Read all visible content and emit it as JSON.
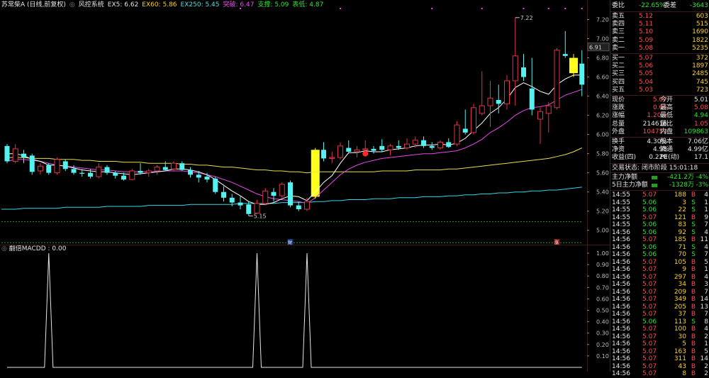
{
  "colors": {
    "bg": "#000000",
    "up": "#e0324a",
    "down": "#55f0f0",
    "ma5": "#ffffff",
    "ex60": "#e6e04a",
    "ex250": "#33d6e6",
    "tupo": "#e64ae6",
    "highlight": "#ffff1e",
    "red": "#ff4d4d",
    "green": "#2ee52e",
    "yellow": "#ffd21e"
  },
  "header": {
    "stock": "苏常柴A (日线,前复权)",
    "indicator": "风控系统",
    "ex5": "EX5: 6.62",
    "ex60": "EX60: 5.86",
    "ex250": "EX250: 5.45",
    "tupo": "突破: 6.47",
    "zhicheng": "支撑: 5.09",
    "biaodi": "表低: 4.87"
  },
  "sub": {
    "title": "翻倍MACDD : 0.00"
  },
  "chart_data": [
    {
      "type": "candlestick",
      "title": "苏常柴A (日线,前复权)",
      "ylim": [
        4.85,
        7.3
      ],
      "yticks": [
        "7.20",
        "7.00",
        "6.80",
        "6.60",
        "6.40",
        "6.20",
        "6.00",
        "5.80",
        "5.60",
        "5.40",
        "5.20",
        "5.00"
      ],
      "last_price_label": "6.91",
      "candles": [
        {
          "o": 5.88,
          "h": 5.9,
          "l": 5.7,
          "c": 5.72
        },
        {
          "o": 5.72,
          "h": 5.9,
          "l": 5.7,
          "c": 5.85
        },
        {
          "o": 5.8,
          "h": 5.84,
          "l": 5.7,
          "c": 5.76
        },
        {
          "o": 5.78,
          "h": 5.8,
          "l": 5.58,
          "c": 5.61
        },
        {
          "o": 5.62,
          "h": 5.7,
          "l": 5.58,
          "c": 5.67
        },
        {
          "o": 5.68,
          "h": 5.7,
          "l": 5.58,
          "c": 5.6
        },
        {
          "o": 5.6,
          "h": 5.76,
          "l": 5.58,
          "c": 5.74
        },
        {
          "o": 5.72,
          "h": 5.74,
          "l": 5.62,
          "c": 5.64
        },
        {
          "o": 5.64,
          "h": 5.68,
          "l": 5.58,
          "c": 5.6
        },
        {
          "o": 5.6,
          "h": 5.64,
          "l": 5.56,
          "c": 5.59
        },
        {
          "o": 5.6,
          "h": 5.64,
          "l": 5.54,
          "c": 5.56
        },
        {
          "o": 5.56,
          "h": 5.7,
          "l": 5.54,
          "c": 5.66
        },
        {
          "o": 5.66,
          "h": 5.68,
          "l": 5.58,
          "c": 5.6
        },
        {
          "o": 5.6,
          "h": 5.62,
          "l": 5.54,
          "c": 5.57
        },
        {
          "o": 5.57,
          "h": 5.6,
          "l": 5.52,
          "c": 5.53
        },
        {
          "o": 5.53,
          "h": 5.64,
          "l": 5.52,
          "c": 5.62
        },
        {
          "o": 5.62,
          "h": 5.7,
          "l": 5.58,
          "c": 5.6
        },
        {
          "o": 5.6,
          "h": 5.64,
          "l": 5.56,
          "c": 5.62
        },
        {
          "o": 5.62,
          "h": 5.68,
          "l": 5.58,
          "c": 5.66
        },
        {
          "o": 5.66,
          "h": 5.72,
          "l": 5.62,
          "c": 5.63
        },
        {
          "o": 5.64,
          "h": 5.72,
          "l": 5.62,
          "c": 5.7
        },
        {
          "o": 5.7,
          "h": 5.72,
          "l": 5.62,
          "c": 5.63
        },
        {
          "o": 5.63,
          "h": 5.66,
          "l": 5.55,
          "c": 5.58
        },
        {
          "o": 5.58,
          "h": 5.62,
          "l": 5.5,
          "c": 5.55
        },
        {
          "o": 5.56,
          "h": 5.6,
          "l": 5.5,
          "c": 5.53
        },
        {
          "o": 5.54,
          "h": 5.56,
          "l": 5.38,
          "c": 5.4
        },
        {
          "o": 5.4,
          "h": 5.46,
          "l": 5.3,
          "c": 5.34
        },
        {
          "o": 5.34,
          "h": 5.38,
          "l": 5.25,
          "c": 5.29
        },
        {
          "o": 5.29,
          "h": 5.36,
          "l": 5.22,
          "c": 5.26
        },
        {
          "o": 5.27,
          "h": 5.3,
          "l": 5.15,
          "c": 5.17
        },
        {
          "o": 5.18,
          "h": 5.32,
          "l": 5.17,
          "c": 5.28
        },
        {
          "o": 5.28,
          "h": 5.44,
          "l": 5.26,
          "c": 5.41
        },
        {
          "o": 5.4,
          "h": 5.44,
          "l": 5.3,
          "c": 5.36
        },
        {
          "o": 5.36,
          "h": 5.5,
          "l": 5.34,
          "c": 5.48
        },
        {
          "o": 5.5,
          "h": 5.52,
          "l": 5.24,
          "c": 5.26
        },
        {
          "o": 5.26,
          "h": 5.3,
          "l": 5.2,
          "c": 5.22
        },
        {
          "o": 5.22,
          "h": 5.34,
          "l": 5.2,
          "c": 5.3
        },
        {
          "o": 5.35,
          "h": 5.86,
          "l": 5.33,
          "c": 5.84
        },
        {
          "o": 5.84,
          "h": 5.92,
          "l": 5.72,
          "c": 5.75
        },
        {
          "o": 5.75,
          "h": 5.82,
          "l": 5.7,
          "c": 5.76
        },
        {
          "o": 5.76,
          "h": 5.92,
          "l": 5.74,
          "c": 5.88
        },
        {
          "o": 5.86,
          "h": 5.94,
          "l": 5.8,
          "c": 5.82
        },
        {
          "o": 5.82,
          "h": 5.88,
          "l": 5.76,
          "c": 5.84
        },
        {
          "o": 5.84,
          "h": 5.94,
          "l": 5.8,
          "c": 5.85
        },
        {
          "o": 5.85,
          "h": 5.88,
          "l": 5.8,
          "c": 5.83
        },
        {
          "o": 5.88,
          "h": 5.95,
          "l": 5.82,
          "c": 5.84
        },
        {
          "o": 5.84,
          "h": 5.9,
          "l": 5.78,
          "c": 5.88
        },
        {
          "o": 5.88,
          "h": 5.94,
          "l": 5.84,
          "c": 5.86
        },
        {
          "o": 5.86,
          "h": 5.96,
          "l": 5.84,
          "c": 5.9
        },
        {
          "o": 5.9,
          "h": 5.98,
          "l": 5.86,
          "c": 5.94
        },
        {
          "o": 5.94,
          "h": 5.98,
          "l": 5.86,
          "c": 5.88
        },
        {
          "o": 5.88,
          "h": 5.92,
          "l": 5.84,
          "c": 5.86
        },
        {
          "o": 5.86,
          "h": 5.94,
          "l": 5.84,
          "c": 5.92
        },
        {
          "o": 5.92,
          "h": 5.96,
          "l": 5.86,
          "c": 5.87
        },
        {
          "o": 5.9,
          "h": 6.14,
          "l": 5.88,
          "c": 6.1
        },
        {
          "o": 6.06,
          "h": 6.26,
          "l": 6.0,
          "c": 6.02
        },
        {
          "o": 6.02,
          "h": 6.32,
          "l": 6.0,
          "c": 6.28
        },
        {
          "o": 6.22,
          "h": 6.66,
          "l": 6.2,
          "c": 6.3
        },
        {
          "o": 6.3,
          "h": 6.56,
          "l": 6.08,
          "c": 6.38
        },
        {
          "o": 6.36,
          "h": 6.52,
          "l": 6.22,
          "c": 6.32
        },
        {
          "o": 6.32,
          "h": 6.62,
          "l": 6.26,
          "c": 6.56
        },
        {
          "o": 6.56,
          "h": 7.22,
          "l": 6.3,
          "c": 6.82
        },
        {
          "o": 6.7,
          "h": 6.84,
          "l": 6.56,
          "c": 6.6
        },
        {
          "o": 6.48,
          "h": 6.8,
          "l": 6.2,
          "c": 6.26
        },
        {
          "o": 6.16,
          "h": 6.28,
          "l": 5.9,
          "c": 6.24
        },
        {
          "o": 6.22,
          "h": 6.34,
          "l": 6.02,
          "c": 6.3
        },
        {
          "o": 6.28,
          "h": 6.9,
          "l": 6.26,
          "c": 6.88
        },
        {
          "o": 6.84,
          "h": 7.08,
          "l": 6.8,
          "c": 6.82
        },
        {
          "o": 6.8,
          "h": 6.84,
          "l": 6.6,
          "c": 6.64
        },
        {
          "o": 6.74,
          "h": 6.88,
          "l": 6.4,
          "c": 6.52
        }
      ],
      "highlight_candles": [
        37,
        68
      ],
      "lines": {
        "ma5": [
          5.8,
          5.8,
          5.78,
          5.74,
          5.72,
          5.68,
          5.68,
          5.67,
          5.65,
          5.63,
          5.62,
          5.61,
          5.61,
          5.6,
          5.59,
          5.58,
          5.59,
          5.6,
          5.61,
          5.62,
          5.64,
          5.64,
          5.63,
          5.61,
          5.58,
          5.53,
          5.47,
          5.41,
          5.36,
          5.3,
          5.27,
          5.27,
          5.29,
          5.33,
          5.36,
          5.35,
          5.31,
          5.4,
          5.5,
          5.57,
          5.7,
          5.81,
          5.81,
          5.83,
          5.82,
          5.82,
          5.84,
          5.85,
          5.86,
          5.88,
          5.89,
          5.89,
          5.9,
          5.89,
          5.91,
          5.96,
          6.04,
          6.12,
          6.22,
          6.28,
          6.37,
          6.49,
          6.54,
          6.5,
          6.45,
          6.42,
          6.52,
          6.58,
          6.62,
          6.62
        ],
        "ex60": [
          5.76,
          5.76,
          5.76,
          5.75,
          5.75,
          5.75,
          5.74,
          5.74,
          5.74,
          5.73,
          5.73,
          5.72,
          5.72,
          5.72,
          5.71,
          5.71,
          5.71,
          5.7,
          5.7,
          5.7,
          5.7,
          5.69,
          5.69,
          5.68,
          5.68,
          5.67,
          5.66,
          5.66,
          5.65,
          5.64,
          5.63,
          5.63,
          5.62,
          5.62,
          5.61,
          5.61,
          5.6,
          5.61,
          5.61,
          5.61,
          5.61,
          5.61,
          5.61,
          5.61,
          5.61,
          5.62,
          5.62,
          5.62,
          5.62,
          5.63,
          5.63,
          5.63,
          5.63,
          5.64,
          5.64,
          5.65,
          5.66,
          5.67,
          5.68,
          5.69,
          5.7,
          5.71,
          5.72,
          5.73,
          5.74,
          5.75,
          5.77,
          5.79,
          5.82,
          5.86
        ],
        "ex250": [
          5.22,
          5.22,
          5.23,
          5.23,
          5.23,
          5.23,
          5.23,
          5.24,
          5.24,
          5.24,
          5.24,
          5.24,
          5.25,
          5.25,
          5.25,
          5.25,
          5.25,
          5.26,
          5.26,
          5.26,
          5.26,
          5.26,
          5.27,
          5.27,
          5.27,
          5.27,
          5.27,
          5.27,
          5.28,
          5.28,
          5.28,
          5.28,
          5.28,
          5.29,
          5.29,
          5.29,
          5.29,
          5.3,
          5.3,
          5.31,
          5.31,
          5.32,
          5.32,
          5.32,
          5.33,
          5.33,
          5.33,
          5.34,
          5.34,
          5.34,
          5.35,
          5.35,
          5.35,
          5.36,
          5.36,
          5.37,
          5.37,
          5.38,
          5.38,
          5.39,
          5.39,
          5.4,
          5.4,
          5.41,
          5.41,
          5.42,
          5.42,
          5.43,
          5.44,
          5.45
        ],
        "tupo": [
          5.72,
          5.74,
          5.74,
          5.73,
          5.72,
          5.7,
          5.68,
          5.67,
          5.66,
          5.65,
          5.64,
          5.63,
          5.63,
          5.62,
          5.61,
          5.61,
          5.61,
          5.61,
          5.61,
          5.62,
          5.62,
          5.62,
          5.61,
          5.6,
          5.58,
          5.56,
          5.53,
          5.5,
          5.46,
          5.42,
          5.38,
          5.35,
          5.33,
          5.32,
          5.31,
          5.3,
          5.28,
          5.34,
          5.42,
          5.5,
          5.58,
          5.64,
          5.68,
          5.71,
          5.73,
          5.75,
          5.76,
          5.77,
          5.78,
          5.79,
          5.8,
          5.8,
          5.81,
          5.82,
          5.83,
          5.86,
          5.9,
          5.95,
          6.02,
          6.07,
          6.13,
          6.2,
          6.25,
          6.28,
          6.29,
          6.31,
          6.36,
          6.41,
          6.44,
          6.47
        ]
      },
      "dashed_levels": [
        5.09,
        4.87
      ],
      "annotations": [
        {
          "text": "7.22",
          "candle": 61,
          "price": 7.22
        },
        {
          "text": "5.15",
          "candle": 29,
          "price": 5.15
        }
      ],
      "top_markers": [
        28,
        40,
        51,
        57,
        62,
        65,
        67,
        69
      ],
      "bottom_marks": [
        {
          "text": "财",
          "candle": 34
        },
        {
          "text": "涨",
          "candle": 66
        }
      ]
    },
    {
      "type": "line",
      "title": "翻倍MACDD : 0.00",
      "ylim": [
        0,
        1
      ],
      "yticks": [
        "1.00",
        "0.90",
        "0.80",
        "0.70",
        "0.60",
        "0.50",
        "0.40",
        "0.30",
        "0.20",
        "0.10"
      ],
      "spikes": [
        5,
        30,
        36
      ]
    }
  ],
  "panel": {
    "weibi": {
      "label": "委比",
      "value": "-22.65%",
      "label2": "委差",
      "value2": "-3643"
    },
    "asks": [
      {
        "label": "卖五",
        "price": "5.12",
        "vol": "603"
      },
      {
        "label": "卖四",
        "price": "5.11",
        "vol": "515"
      },
      {
        "label": "卖三",
        "price": "5.10",
        "vol": "1690"
      },
      {
        "label": "卖二",
        "price": "5.09",
        "vol": "1822"
      },
      {
        "label": "卖一",
        "price": "5.08",
        "vol": "5235"
      }
    ],
    "bids": [
      {
        "label": "买一",
        "price": "5.07",
        "vol": "372"
      },
      {
        "label": "买二",
        "price": "5.06",
        "vol": "1897"
      },
      {
        "label": "买三",
        "price": "5.05",
        "vol": "2485"
      },
      {
        "label": "买四",
        "price": "5.04",
        "vol": "745"
      },
      {
        "label": "买五",
        "price": "5.03",
        "vol": "723"
      }
    ],
    "stats": [
      {
        "l1": "现价",
        "v1": "5.07",
        "c1": "red",
        "l2": "今开",
        "v2": "5.01",
        "c2": "white"
      },
      {
        "l1": "涨跌",
        "v1": "0.06",
        "c1": "red",
        "l2": "最高",
        "v2": "5.08",
        "c2": "red"
      },
      {
        "l1": "涨幅",
        "v1": "1.20%",
        "c1": "red",
        "l2": "最低",
        "v2": "4.94",
        "c2": "green"
      },
      {
        "l1": "总量",
        "v1": "214616",
        "c1": "white",
        "l2": "量比",
        "v2": "1.05",
        "c2": "red"
      },
      {
        "l1": "外盘",
        "v1": "104753",
        "c1": "red",
        "l2": "内盘",
        "v2": "109863",
        "c2": "green"
      }
    ],
    "stats2": [
      {
        "l1": "换手",
        "v1": "4.30%",
        "l2": "股本",
        "v2": "7.06亿"
      },
      {
        "l1": "净资",
        "v1": "4.98",
        "l2": "流通",
        "v2": "4.99亿"
      },
      {
        "l1": "收益(四)",
        "v1": "0.220",
        "l2": "PE(动)",
        "v2": "17.1"
      }
    ],
    "trade_status": "交易状态: 闭市阶段 15:01:18",
    "flows": [
      {
        "label": "主力净额",
        "value": "-421.2万",
        "pct": "-4%"
      },
      {
        "label": "5日主力净额",
        "value": "-1328万",
        "pct": "-3%"
      }
    ],
    "trades": [
      {
        "t": "14:55",
        "p": "5.07",
        "v": "188",
        "d": "B",
        "n": "4"
      },
      {
        "t": "14:55",
        "p": "5.06",
        "v": "3",
        "d": "S",
        "n": "1"
      },
      {
        "t": "14:55",
        "p": "5.06",
        "v": "22",
        "d": "S",
        "n": "1"
      },
      {
        "t": "14:55",
        "p": "5.07",
        "v": "121",
        "d": "B",
        "n": "9"
      },
      {
        "t": "14:55",
        "p": "5.06",
        "v": "83",
        "d": "S",
        "n": "7"
      },
      {
        "t": "14:56",
        "p": "5.06",
        "v": "92",
        "d": "S",
        "n": "4"
      },
      {
        "t": "14:56",
        "p": "5.07",
        "v": "185",
        "d": "B",
        "n": "11"
      },
      {
        "t": "14:56",
        "p": "5.06",
        "v": "71",
        "d": "S",
        "n": "4"
      },
      {
        "t": "14:56",
        "p": "5.06",
        "v": "70",
        "d": "S",
        "n": "7"
      },
      {
        "t": "14:56",
        "p": "5.07",
        "v": "105",
        "d": "B",
        "n": "5"
      },
      {
        "t": "14:56",
        "p": "5.07",
        "v": "9",
        "d": "B",
        "n": "1"
      },
      {
        "t": "14:56",
        "p": "5.07",
        "v": "297",
        "d": "B",
        "n": "4"
      },
      {
        "t": "14:56",
        "p": "5.07",
        "v": "34",
        "d": "B",
        "n": "3"
      },
      {
        "t": "14:56",
        "p": "5.07",
        "v": "209",
        "d": "B",
        "n": "7"
      },
      {
        "t": "14:56",
        "p": "5.07",
        "v": "349",
        "d": "B",
        "n": "14"
      },
      {
        "t": "14:56",
        "p": "5.07",
        "v": "205",
        "d": "B",
        "n": "13"
      },
      {
        "t": "14:56",
        "p": "5.07",
        "v": "37",
        "d": "B",
        "n": "7"
      },
      {
        "t": "14:56",
        "p": "5.06",
        "v": "113",
        "d": "S",
        "n": "8"
      },
      {
        "t": "14:56",
        "p": "5.07",
        "v": "100",
        "d": "B",
        "n": "4"
      },
      {
        "t": "14:56",
        "p": "5.07",
        "v": "30",
        "d": "B",
        "n": "2"
      },
      {
        "t": "14:56",
        "p": "5.07",
        "v": "5",
        "d": "B",
        "n": "1"
      },
      {
        "t": "14:56",
        "p": "5.07",
        "v": "163",
        "d": "B",
        "n": "5"
      },
      {
        "t": "14:56",
        "p": "5.07",
        "v": "311",
        "d": "B",
        "n": "14"
      },
      {
        "t": "14:56",
        "p": "5.07",
        "v": "43",
        "d": "B",
        "n": "2"
      },
      {
        "t": "14:56",
        "p": "5.07",
        "v": "8",
        "d": "B",
        "n": "2"
      }
    ]
  }
}
